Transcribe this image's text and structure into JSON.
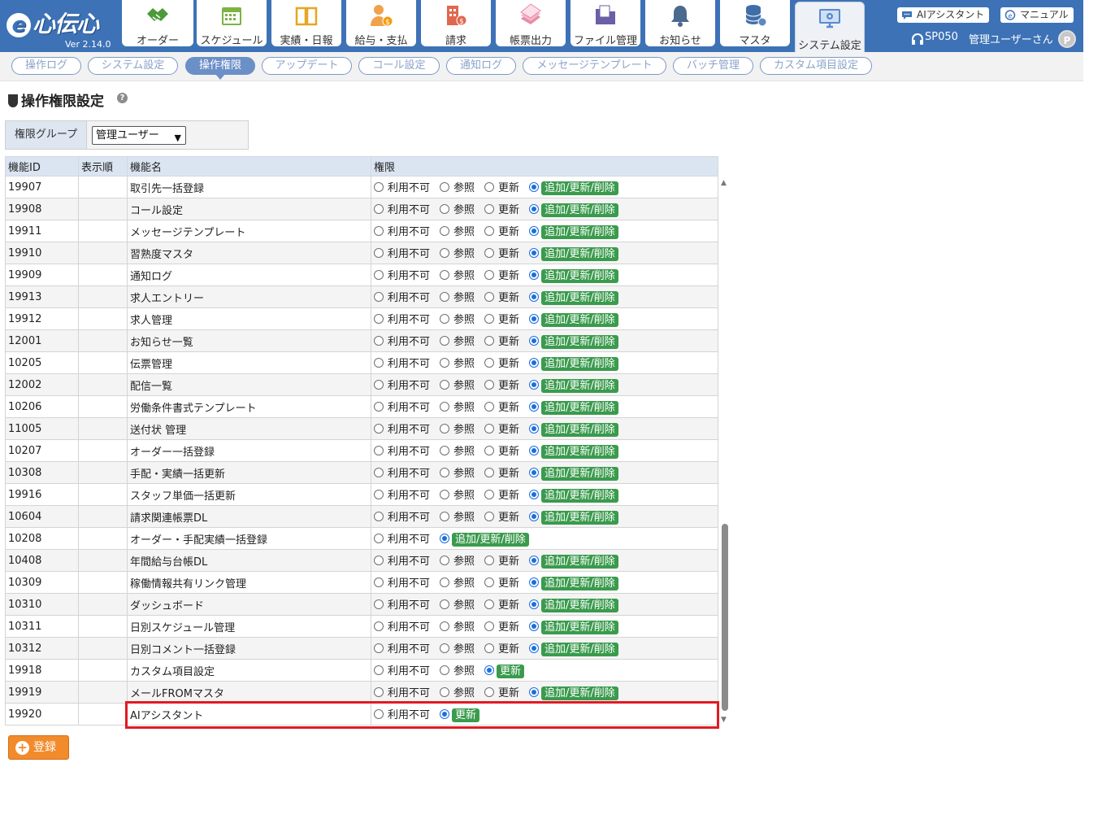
{
  "app": {
    "logo_text": "e心伝心",
    "version": "Ver 2.14.0"
  },
  "nav": {
    "tabs": [
      {
        "label": "オーダー",
        "icon": "handshake-icon"
      },
      {
        "label": "スケジュール",
        "icon": "calendar-icon"
      },
      {
        "label": "実績・日報",
        "icon": "book-icon"
      },
      {
        "label": "給与・支払",
        "icon": "person-money-icon"
      },
      {
        "label": "請求",
        "icon": "building-money-icon"
      },
      {
        "label": "帳票出力",
        "icon": "documents-icon"
      },
      {
        "label": "ファイル管理",
        "icon": "folder-icon"
      },
      {
        "label": "お知らせ",
        "icon": "bell-icon"
      },
      {
        "label": "マスタ",
        "icon": "database-icon"
      },
      {
        "label": "システム設定",
        "icon": "system-settings-icon"
      }
    ],
    "ai_assistant_label": "AIアシスタント",
    "manual_label": "マニュアル",
    "user_code": "SP050",
    "user_name": "管理ユーザーさん"
  },
  "subnav": {
    "items": [
      "操作ログ",
      "システム設定",
      "操作権限",
      "アップデート",
      "コール設定",
      "通知ログ",
      "メッセージテンプレート",
      "バッチ管理",
      "カスタム項目設定"
    ],
    "active": "操作権限"
  },
  "page": {
    "title": "操作権限設定",
    "group_label": "権限グループ",
    "group_value": "管理ユーザー"
  },
  "table": {
    "headers": [
      "機能ID",
      "表示順",
      "機能名",
      "権限"
    ],
    "option_labels": {
      "none": "利用不可",
      "view": "参照",
      "update": "更新",
      "full": "追加/更新/削除"
    },
    "rows": [
      {
        "id": "19907",
        "order": "",
        "name": "取引先一括登録",
        "options": [
          "none",
          "view",
          "update",
          "full"
        ],
        "selected": "full"
      },
      {
        "id": "19908",
        "order": "",
        "name": "コール設定",
        "options": [
          "none",
          "view",
          "update",
          "full"
        ],
        "selected": "full"
      },
      {
        "id": "19911",
        "order": "",
        "name": "メッセージテンプレート",
        "options": [
          "none",
          "view",
          "update",
          "full"
        ],
        "selected": "full"
      },
      {
        "id": "19910",
        "order": "",
        "name": "習熟度マスタ",
        "options": [
          "none",
          "view",
          "update",
          "full"
        ],
        "selected": "full"
      },
      {
        "id": "19909",
        "order": "",
        "name": "通知ログ",
        "options": [
          "none",
          "view",
          "update",
          "full"
        ],
        "selected": "full"
      },
      {
        "id": "19913",
        "order": "",
        "name": "求人エントリー",
        "options": [
          "none",
          "view",
          "update",
          "full"
        ],
        "selected": "full"
      },
      {
        "id": "19912",
        "order": "",
        "name": "求人管理",
        "options": [
          "none",
          "view",
          "update",
          "full"
        ],
        "selected": "full"
      },
      {
        "id": "12001",
        "order": "",
        "name": "お知らせ一覧",
        "options": [
          "none",
          "view",
          "update",
          "full"
        ],
        "selected": "full"
      },
      {
        "id": "10205",
        "order": "",
        "name": "伝票管理",
        "options": [
          "none",
          "view",
          "update",
          "full"
        ],
        "selected": "full"
      },
      {
        "id": "12002",
        "order": "",
        "name": "配信一覧",
        "options": [
          "none",
          "view",
          "update",
          "full"
        ],
        "selected": "full"
      },
      {
        "id": "10206",
        "order": "",
        "name": "労働条件書式テンプレート",
        "options": [
          "none",
          "view",
          "update",
          "full"
        ],
        "selected": "full"
      },
      {
        "id": "11005",
        "order": "",
        "name": "送付状 管理",
        "options": [
          "none",
          "view",
          "update",
          "full"
        ],
        "selected": "full"
      },
      {
        "id": "10207",
        "order": "",
        "name": "オーダー一括登録",
        "options": [
          "none",
          "view",
          "update",
          "full"
        ],
        "selected": "full"
      },
      {
        "id": "10308",
        "order": "",
        "name": "手配・実績一括更新",
        "options": [
          "none",
          "view",
          "update",
          "full"
        ],
        "selected": "full"
      },
      {
        "id": "19916",
        "order": "",
        "name": "スタッフ単価一括更新",
        "options": [
          "none",
          "view",
          "update",
          "full"
        ],
        "selected": "full"
      },
      {
        "id": "10604",
        "order": "",
        "name": "請求関連帳票DL",
        "options": [
          "none",
          "view",
          "update",
          "full"
        ],
        "selected": "full"
      },
      {
        "id": "10208",
        "order": "",
        "name": "オーダー・手配実績一括登録",
        "options": [
          "none",
          "full"
        ],
        "selected": "full"
      },
      {
        "id": "10408",
        "order": "",
        "name": "年間給与台帳DL",
        "options": [
          "none",
          "view",
          "update",
          "full"
        ],
        "selected": "full"
      },
      {
        "id": "10309",
        "order": "",
        "name": "稼働情報共有リンク管理",
        "options": [
          "none",
          "view",
          "update",
          "full"
        ],
        "selected": "full"
      },
      {
        "id": "10310",
        "order": "",
        "name": "ダッシュボード",
        "options": [
          "none",
          "view",
          "update",
          "full"
        ],
        "selected": "full"
      },
      {
        "id": "10311",
        "order": "",
        "name": "日別スケジュール管理",
        "options": [
          "none",
          "view",
          "update",
          "full"
        ],
        "selected": "full"
      },
      {
        "id": "10312",
        "order": "",
        "name": "日別コメント一括登録",
        "options": [
          "none",
          "view",
          "update",
          "full"
        ],
        "selected": "full"
      },
      {
        "id": "19918",
        "order": "",
        "name": "カスタム項目設定",
        "options": [
          "none",
          "view",
          "update"
        ],
        "selected": "update"
      },
      {
        "id": "19919",
        "order": "",
        "name": "メールFROMマスタ",
        "options": [
          "none",
          "view",
          "update",
          "full"
        ],
        "selected": "full"
      },
      {
        "id": "19920",
        "order": "",
        "name": "AIアシスタント",
        "options": [
          "none",
          "update"
        ],
        "selected": "update"
      }
    ]
  },
  "register_label": "登録",
  "colors": {
    "header_bg": "#3d72b6",
    "badge_green": "#3a9b4d",
    "highlight_red": "#e01b24",
    "register_orange": "#f28b2c"
  }
}
